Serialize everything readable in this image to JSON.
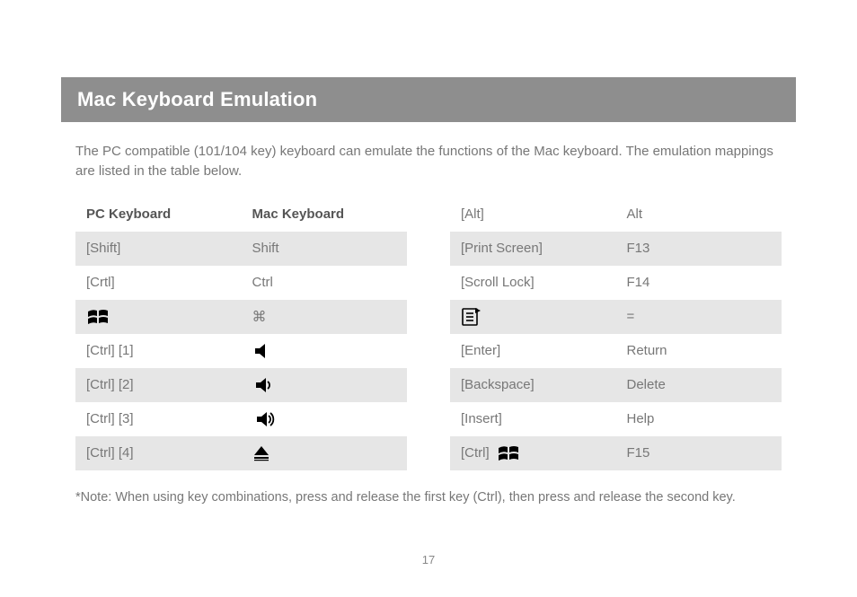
{
  "title": "Mac Keyboard Emulation",
  "intro": "The PC compatible (101/104 key) keyboard can emulate the functions of the Mac keyboard. The emulation mappings are listed in the table below.",
  "page_number": "17",
  "footnote": "*Note: When using key combinations, press and release the first key (Ctrl), then press and release the second key.",
  "glyphs": {
    "command": "⌘"
  },
  "left_table": {
    "headers": {
      "pc": "PC Keyboard",
      "mac": "Mac Keyboard"
    },
    "rows": [
      {
        "pc": "[Shift]",
        "mac_text": "Shift",
        "mac_icon": null,
        "stripe": true
      },
      {
        "pc": "[Crtl]",
        "mac_text": "Ctrl",
        "mac_icon": null,
        "stripe": false
      },
      {
        "pc_icon": "windows-logo",
        "pc": "",
        "mac_text": "",
        "mac_icon": "command",
        "stripe": true
      },
      {
        "pc": "[Ctrl] [1]",
        "mac_text": "",
        "mac_icon": "speaker-mute",
        "stripe": false
      },
      {
        "pc": "[Ctrl] [2]",
        "mac_text": "",
        "mac_icon": "speaker-low",
        "stripe": true
      },
      {
        "pc": "[Ctrl] [3]",
        "mac_text": "",
        "mac_icon": "speaker-high",
        "stripe": false
      },
      {
        "pc": "[Ctrl] [4]",
        "mac_text": "",
        "mac_icon": "eject",
        "stripe": true
      }
    ]
  },
  "right_table": {
    "rows": [
      {
        "pc": "[Alt]",
        "mac_text": "Alt",
        "stripe": false
      },
      {
        "pc": "[Print Screen]",
        "mac_text": "F13",
        "stripe": true
      },
      {
        "pc": "[Scroll Lock]",
        "mac_text": "F14",
        "stripe": false
      },
      {
        "pc_icon": "menu-key",
        "pc": "",
        "mac_text": "=",
        "stripe": true
      },
      {
        "pc": "[Enter]",
        "mac_text": "Return",
        "stripe": false
      },
      {
        "pc": "[Backspace]",
        "mac_text": "Delete",
        "stripe": true
      },
      {
        "pc": "[Insert]",
        "mac_text": "Help",
        "stripe": false
      },
      {
        "pc": "[Ctrl]",
        "pc_icon_after": "windows-logo",
        "mac_text": "F15",
        "stripe": true
      }
    ]
  }
}
